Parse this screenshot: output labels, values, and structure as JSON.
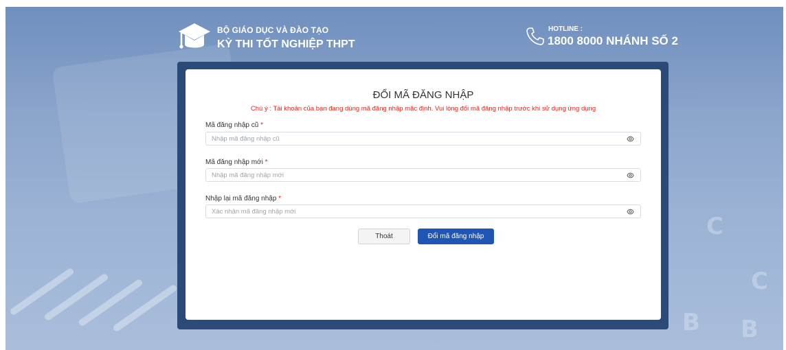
{
  "header": {
    "org_name": "BỘ GIÁO DỤC VÀ ĐÀO TẠO",
    "exam_name": "KỲ THI TỐT NGHIỆP THPT",
    "hotline_label": "HOTLINE :",
    "hotline_number": "1800 8000 NHÁNH SỐ 2"
  },
  "form": {
    "title": "ĐỔI MÃ ĐĂNG NHẬP",
    "notice": "Chú ý : Tài khoản của bạn đang dùng mã đăng nhập mặc định. Vui lòng đổi mã đăng nhập trước khi sử dụng ứng dụng",
    "required_mark": "*",
    "fields": [
      {
        "label": "Mã đăng nhập cũ",
        "value": "",
        "placeholder": "Nhập mã đăng nhập cũ"
      },
      {
        "label": "Mã đăng nhập mới",
        "value": "",
        "placeholder": "Nhập mã đăng nhập mới"
      },
      {
        "label": "Nhập lại mã đăng nhập",
        "value": "",
        "placeholder": "Xác nhận mã đăng nhập mới"
      }
    ],
    "exit_label": "Thoát",
    "submit_label": "Đổi mã đăng nhập"
  },
  "colors": {
    "primary": "#1f56b5",
    "required": "#e0271b",
    "frame": "#2c4a78"
  },
  "icons": {
    "logo": "graduation-cap-icon",
    "phone": "phone-icon",
    "reveal": "eye-icon"
  }
}
